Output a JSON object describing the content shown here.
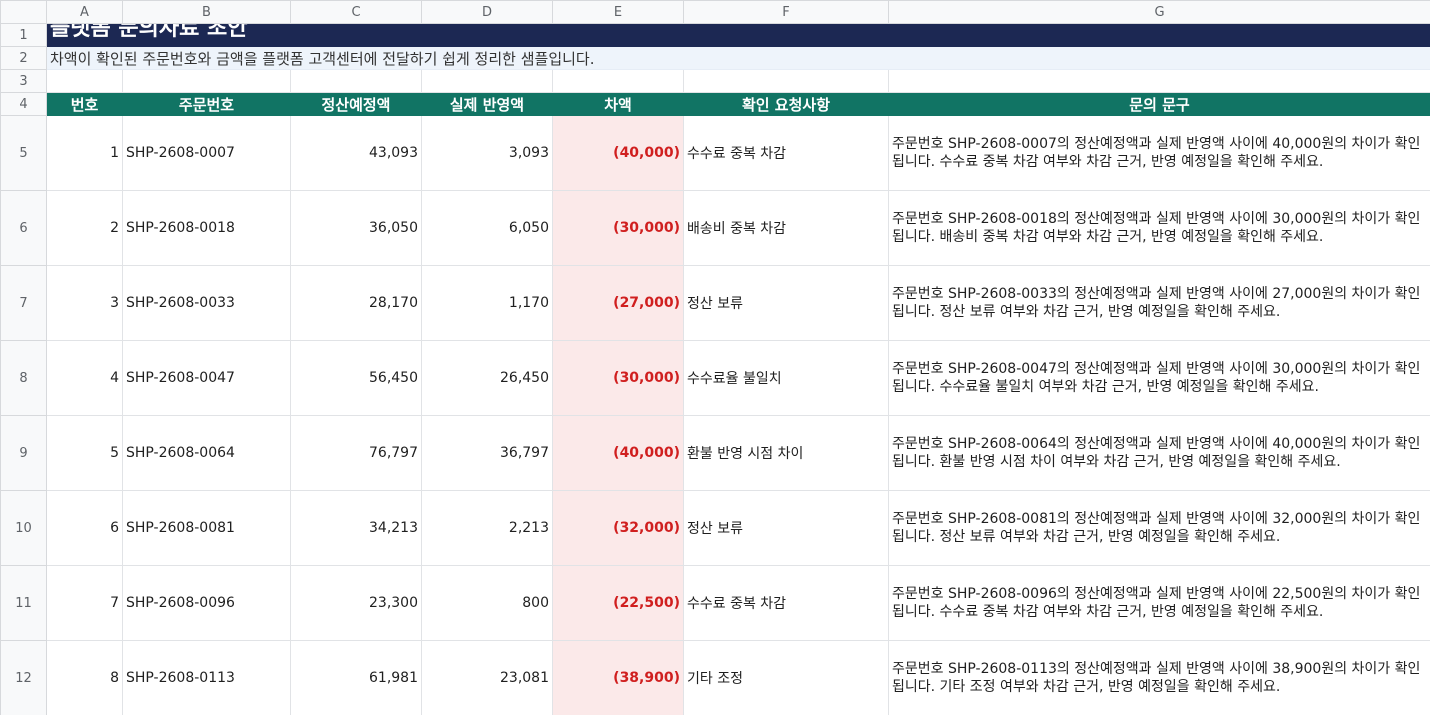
{
  "columns": [
    "A",
    "B",
    "C",
    "D",
    "E",
    "F",
    "G"
  ],
  "row_numbers": [
    "1",
    "2",
    "3",
    "4",
    "5",
    "6",
    "7",
    "8",
    "9",
    "10",
    "11",
    "12"
  ],
  "title": "플랫폼 문의자료 초안",
  "subtitle": "차액이 확인된 주문번호와 금액을 플랫폼 고객센터에 전달하기 쉽게 정리한 샘플입니다.",
  "headers": [
    "번호",
    "주문번호",
    "정산예정액",
    "실제 반영액",
    "차액",
    "확인 요청사항",
    "문의 문구"
  ],
  "rows": [
    {
      "no": "1",
      "order": "SHP-2608-0007",
      "expected": "43,093",
      "actual": "3,093",
      "diff": "(40,000)",
      "request": "수수료 중복 차감",
      "message": "주문번호 SHP-2608-0007의 정산예정액과 실제 반영액 사이에 40,000원의 차이가 확인됩니다. 수수료 중복 차감 여부와 차감 근거, 반영 예정일을 확인해 주세요."
    },
    {
      "no": "2",
      "order": "SHP-2608-0018",
      "expected": "36,050",
      "actual": "6,050",
      "diff": "(30,000)",
      "request": "배송비 중복 차감",
      "message": "주문번호 SHP-2608-0018의 정산예정액과 실제 반영액 사이에 30,000원의 차이가 확인됩니다. 배송비 중복 차감 여부와 차감 근거, 반영 예정일을 확인해 주세요."
    },
    {
      "no": "3",
      "order": "SHP-2608-0033",
      "expected": "28,170",
      "actual": "1,170",
      "diff": "(27,000)",
      "request": "정산 보류",
      "message": "주문번호 SHP-2608-0033의 정산예정액과 실제 반영액 사이에 27,000원의 차이가 확인됩니다. 정산 보류 여부와 차감 근거, 반영 예정일을 확인해 주세요."
    },
    {
      "no": "4",
      "order": "SHP-2608-0047",
      "expected": "56,450",
      "actual": "26,450",
      "diff": "(30,000)",
      "request": "수수료율 불일치",
      "message": "주문번호 SHP-2608-0047의 정산예정액과 실제 반영액 사이에 30,000원의 차이가 확인됩니다. 수수료율 불일치 여부와 차감 근거, 반영 예정일을 확인해 주세요."
    },
    {
      "no": "5",
      "order": "SHP-2608-0064",
      "expected": "76,797",
      "actual": "36,797",
      "diff": "(40,000)",
      "request": "환불 반영 시점 차이",
      "message": "주문번호 SHP-2608-0064의 정산예정액과 실제 반영액 사이에 40,000원의 차이가 확인됩니다. 환불 반영 시점 차이 여부와 차감 근거, 반영 예정일을 확인해 주세요."
    },
    {
      "no": "6",
      "order": "SHP-2608-0081",
      "expected": "34,213",
      "actual": "2,213",
      "diff": "(32,000)",
      "request": "정산 보류",
      "message": "주문번호 SHP-2608-0081의 정산예정액과 실제 반영액 사이에 32,000원의 차이가 확인됩니다. 정산 보류 여부와 차감 근거, 반영 예정일을 확인해 주세요."
    },
    {
      "no": "7",
      "order": "SHP-2608-0096",
      "expected": "23,300",
      "actual": "800",
      "diff": "(22,500)",
      "request": "수수료 중복 차감",
      "message": "주문번호 SHP-2608-0096의 정산예정액과 실제 반영액 사이에 22,500원의 차이가 확인됩니다. 수수료 중복 차감 여부와 차감 근거, 반영 예정일을 확인해 주세요."
    },
    {
      "no": "8",
      "order": "SHP-2608-0113",
      "expected": "61,981",
      "actual": "23,081",
      "diff": "(38,900)",
      "request": "기타 조정",
      "message": "주문번호 SHP-2608-0113의 정산예정액과 실제 반영액 사이에 38,900원의 차이가 확인됩니다. 기타 조정 여부와 차감 근거, 반영 예정일을 확인해 주세요."
    }
  ],
  "colors": {
    "title_bg": "#1c2853",
    "subtitle_bg": "#eef4fb",
    "header_bg": "#117464",
    "diff_bg": "#fbe9e9",
    "diff_text": "#d01f1f"
  }
}
